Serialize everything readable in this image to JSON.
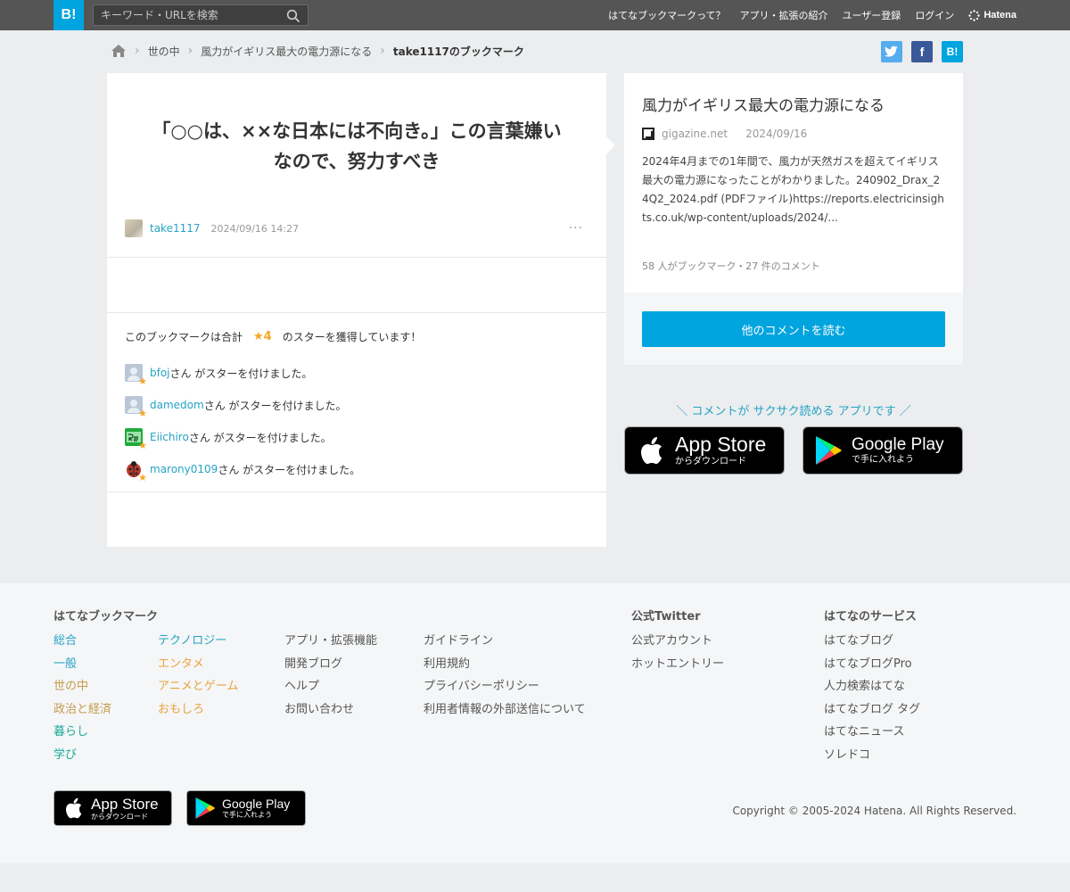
{
  "header": {
    "logo": "B!",
    "search_placeholder": "キーワード・URLを検索",
    "nav": [
      "はてなブックマークって？",
      "アプリ・拡張の紹介",
      "ユーザー登録",
      "ログイン"
    ],
    "brand": "Hatena"
  },
  "breadcrumb": {
    "items": [
      "世の中",
      "風力がイギリス最大の電力源になる"
    ],
    "current": "take1117のブックマーク"
  },
  "share": {
    "twitter": "t",
    "facebook": "f",
    "hatena": "B!"
  },
  "bookmark": {
    "comment": "「○○は、××な日本には不向き。」この言葉嫌いなので、努力すべき",
    "user": "take1117",
    "date": "2024/09/16 14:27",
    "more": "···",
    "star_summary_prefix": "このブックマークは合計",
    "star_count": "★4",
    "star_summary_suffix": "のスターを獲得しています！",
    "stars": [
      {
        "user": "bfoj",
        "suffix": "さん がスターを付けました。"
      },
      {
        "user": "damedom",
        "suffix": "さん がスターを付けました。"
      },
      {
        "user": "Eiichiro",
        "suffix": "さん がスターを付けました。"
      },
      {
        "user": "marony0109",
        "suffix": "さん がスターを付けました。"
      }
    ]
  },
  "entry": {
    "title": "風力がイギリス最大の電力源になる",
    "domain": "gigazine.net",
    "date": "2024/09/16",
    "description": "2024年4月までの1年間で、風力が天然ガスを超えてイギリス最大の電力源になったことがわかりました。240902_Drax_24Q2_2024.pdf (PDFファイル)https://reports.electricinsights.co.uk/wp-content/uploads/2024/...",
    "count": "58 人がブックマーク・27 件のコメント",
    "read_button": "他のコメントを読む"
  },
  "promo": {
    "text": "＼ コメントが サクサク読める アプリです ／",
    "app_store_big": "App Store",
    "app_store_small": "からダウンロード",
    "google_play_big": "Google Play",
    "google_play_small": "で手に入れよう"
  },
  "footer": {
    "col1_title": "はてなブックマーク",
    "col1a": [
      "総合",
      "一般",
      "世の中",
      "政治と経済",
      "暮らし",
      "学び"
    ],
    "col1b": [
      "テクノロジー",
      "エンタメ",
      "アニメとゲーム",
      "おもしろ"
    ],
    "col1c": [
      "アプリ・拡張機能",
      "開発ブログ",
      "ヘルプ",
      "お問い合わせ"
    ],
    "col1d": [
      "ガイドライン",
      "利用規約",
      "プライバシーポリシー",
      "利用者情報の外部送信について"
    ],
    "col2_title": "公式Twitter",
    "col2": [
      "公式アカウント",
      "ホットエントリー"
    ],
    "col3_title": "はてなのサービス",
    "col3": [
      "はてなブログ",
      "はてなブログPro",
      "人力検索はてな",
      "はてなブログ タグ",
      "はてなニュース",
      "ソレドコ"
    ],
    "copyright": "Copyright © 2005-2024 Hatena. All Rights Reserved."
  },
  "colors": {
    "accent": "#00a4de",
    "header_bg": "#555555",
    "link": "#25a3c4",
    "star": "#f5a623"
  }
}
